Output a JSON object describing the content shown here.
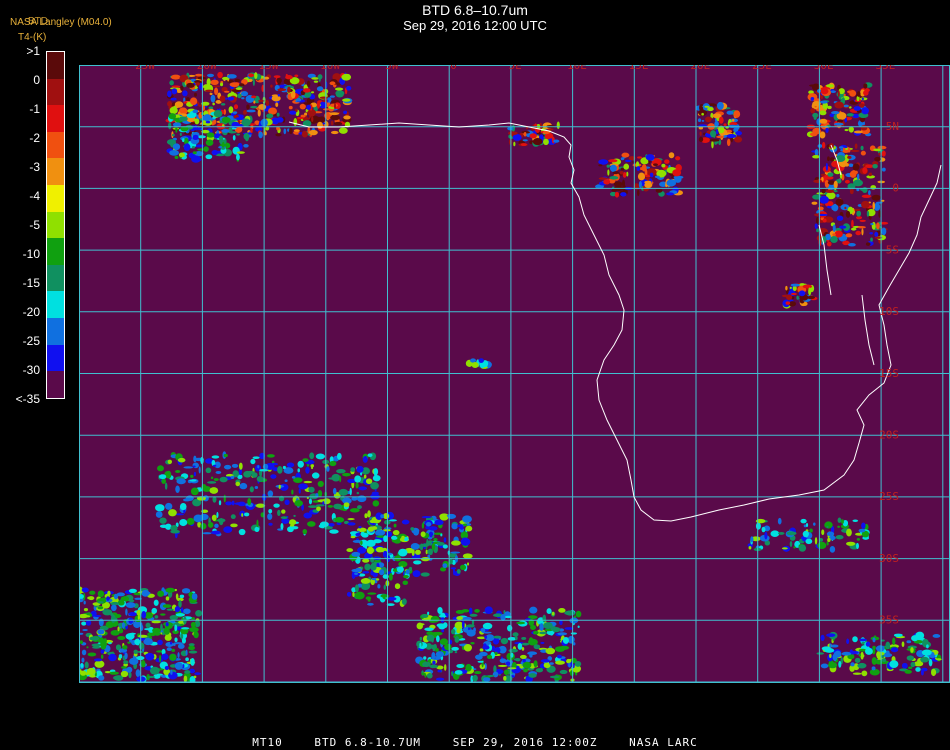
{
  "header": {
    "title": "BTD 6.8–10.7um",
    "datetime": "Sep 29, 2016 12:00 UTC",
    "credit": "NASA Langley (M04.0)",
    "band_label": "BTD",
    "units_label": "T4-(K)"
  },
  "colorbar": {
    "labels": [
      ">1",
      "0",
      "-1",
      "-2",
      "-3",
      "-4",
      "-5",
      "-10",
      "-15",
      "-20",
      "-25",
      "-30",
      "<-35"
    ],
    "colors": [
      "#5a0a0a",
      "#a01010",
      "#e01010",
      "#f05010",
      "#f09010",
      "#f0f000",
      "#90e000",
      "#10a010",
      "#109060",
      "#00e0e0",
      "#1070e0",
      "#1010f0",
      "#5a0a4a"
    ]
  },
  "map": {
    "background_color": "#5a0a4a",
    "grid_color": "#40c0d0",
    "coast_color": "#ffffff",
    "lon_labels": [
      "25W",
      "20W",
      "15W",
      "10W",
      "5W",
      "0",
      "5E",
      "10E",
      "15E",
      "20E",
      "25E",
      "30E",
      "35E"
    ],
    "lat_labels": [
      "5N",
      "0",
      "5S",
      "10S",
      "15S",
      "20S",
      "25S",
      "30S",
      "35S"
    ],
    "label_color": "#c02020"
  },
  "footer": {
    "satellite": "MT10",
    "product": "BTD 6.8-10.7UM",
    "date": "SEP 29, 2016 12:00Z",
    "source": "NASA LARC"
  }
}
